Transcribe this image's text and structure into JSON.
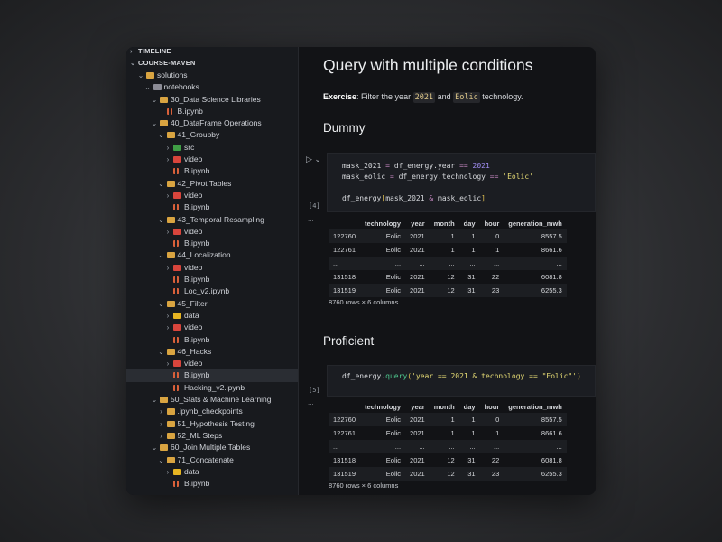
{
  "sidebar": {
    "timeline": "TIMELINE",
    "project": "COURSE-MAVEN",
    "tree": [
      {
        "label": "solutions",
        "depth": 0,
        "type": "folder",
        "chev": "open",
        "color": "#d9a441"
      },
      {
        "label": "notebooks",
        "depth": 1,
        "type": "folder",
        "chev": "open",
        "color": "#8c8c96"
      },
      {
        "label": "30_Data Science Libraries",
        "depth": 2,
        "type": "folder",
        "chev": "open",
        "color": "#d9a441"
      },
      {
        "label": "B.ipynb",
        "depth": 3,
        "type": "file"
      },
      {
        "label": "40_DataFrame Operations",
        "depth": 2,
        "type": "folder",
        "chev": "open",
        "color": "#d9a441"
      },
      {
        "label": "41_Groupby",
        "depth": 3,
        "type": "folder",
        "chev": "open",
        "color": "#d9a441"
      },
      {
        "label": "src",
        "depth": 4,
        "type": "folder",
        "chev": "closed",
        "color": "#3f9e45"
      },
      {
        "label": "video",
        "depth": 4,
        "type": "folder",
        "chev": "closed",
        "color": "#d8453c"
      },
      {
        "label": "B.ipynb",
        "depth": 4,
        "type": "file"
      },
      {
        "label": "42_Pivot Tables",
        "depth": 3,
        "type": "folder",
        "chev": "open",
        "color": "#d9a441"
      },
      {
        "label": "video",
        "depth": 4,
        "type": "folder",
        "chev": "closed",
        "color": "#d8453c"
      },
      {
        "label": "B.ipynb",
        "depth": 4,
        "type": "file"
      },
      {
        "label": "43_Temporal Resampling",
        "depth": 3,
        "type": "folder",
        "chev": "open",
        "color": "#d9a441"
      },
      {
        "label": "video",
        "depth": 4,
        "type": "folder",
        "chev": "closed",
        "color": "#d8453c"
      },
      {
        "label": "B.ipynb",
        "depth": 4,
        "type": "file"
      },
      {
        "label": "44_Localization",
        "depth": 3,
        "type": "folder",
        "chev": "open",
        "color": "#d9a441"
      },
      {
        "label": "video",
        "depth": 4,
        "type": "folder",
        "chev": "closed",
        "color": "#d8453c"
      },
      {
        "label": "B.ipynb",
        "depth": 4,
        "type": "file"
      },
      {
        "label": "Loc_v2.ipynb",
        "depth": 4,
        "type": "file"
      },
      {
        "label": "45_Filter",
        "depth": 3,
        "type": "folder",
        "chev": "open",
        "color": "#d9a441"
      },
      {
        "label": "data",
        "depth": 4,
        "type": "folder",
        "chev": "closed",
        "color": "#e6b422"
      },
      {
        "label": "video",
        "depth": 4,
        "type": "folder",
        "chev": "closed",
        "color": "#d8453c"
      },
      {
        "label": "B.ipynb",
        "depth": 4,
        "type": "file"
      },
      {
        "label": "46_Hacks",
        "depth": 3,
        "type": "folder",
        "chev": "open",
        "color": "#d9a441"
      },
      {
        "label": "video",
        "depth": 4,
        "type": "folder",
        "chev": "closed",
        "color": "#d8453c"
      },
      {
        "label": "B.ipynb",
        "depth": 4,
        "type": "file",
        "selected": true
      },
      {
        "label": "Hacking_v2.ipynb",
        "depth": 4,
        "type": "file"
      },
      {
        "label": "50_Stats & Machine Learning",
        "depth": 2,
        "type": "folder",
        "chev": "open",
        "color": "#d9a441"
      },
      {
        "label": ".ipynb_checkpoints",
        "depth": 3,
        "type": "folder",
        "chev": "closed",
        "color": "#d9a441"
      },
      {
        "label": "51_Hypothesis Testing",
        "depth": 3,
        "type": "folder",
        "chev": "closed",
        "color": "#d9a441"
      },
      {
        "label": "52_ML Steps",
        "depth": 3,
        "type": "folder",
        "chev": "closed",
        "color": "#d9a441"
      },
      {
        "label": "60_Join Multiple Tables",
        "depth": 2,
        "type": "folder",
        "chev": "open",
        "color": "#d9a441"
      },
      {
        "label": "71_Concatenate",
        "depth": 3,
        "type": "folder",
        "chev": "open",
        "color": "#d9a441"
      },
      {
        "label": "data",
        "depth": 4,
        "type": "folder",
        "chev": "closed",
        "color": "#e6b422"
      },
      {
        "label": "B.ipynb",
        "depth": 4,
        "type": "file"
      }
    ]
  },
  "notebook": {
    "title": "Query with multiple conditions",
    "exercise_label": "Exercise",
    "exercise_text1": ": Filter the year ",
    "exercise_code1": "2021",
    "exercise_text2": " and ",
    "exercise_code2": "Eolic",
    "exercise_text3": " technology.",
    "h_dummy": "Dummy",
    "h_proficient": "Proficient",
    "cell1_count": "[4]",
    "cell2_count": "[5]",
    "output_dots": "...",
    "run_icon": "▷ ⌄",
    "columns": [
      "",
      "technology",
      "year",
      "month",
      "day",
      "hour",
      "generation_mwh"
    ],
    "rows": [
      [
        "122760",
        "Eolic",
        "2021",
        "1",
        "1",
        "0",
        "8557.5"
      ],
      [
        "122761",
        "Eolic",
        "2021",
        "1",
        "1",
        "1",
        "8661.6"
      ],
      [
        "...",
        "...",
        "...",
        "...",
        "...",
        "...",
        "..."
      ],
      [
        "131518",
        "Eolic",
        "2021",
        "12",
        "31",
        "22",
        "6081.8"
      ],
      [
        "131519",
        "Eolic",
        "2021",
        "12",
        "31",
        "23",
        "6255.3"
      ]
    ],
    "shape": "8760 rows × 6 columns"
  }
}
